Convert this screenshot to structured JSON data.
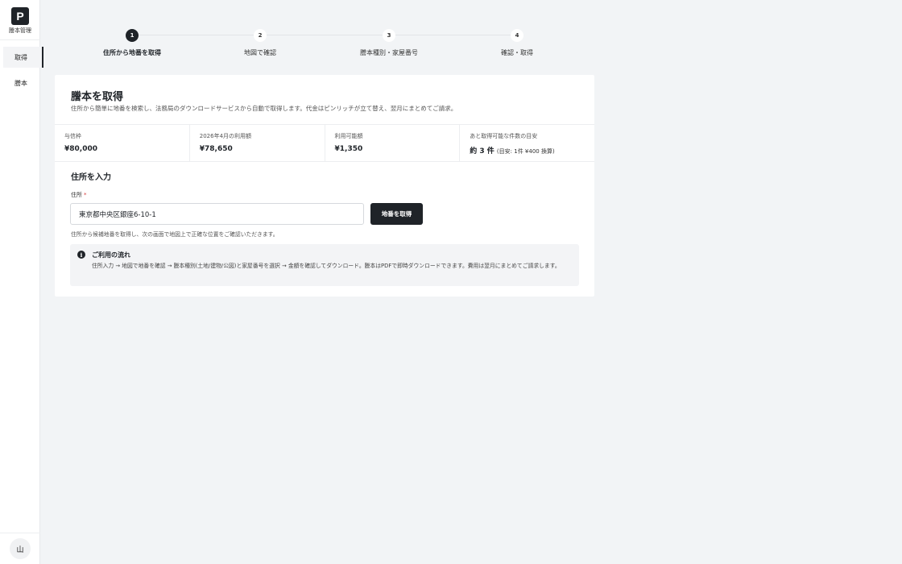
{
  "sidebar": {
    "logo_letter": "P",
    "logo_caption": "謄本管理",
    "items": [
      {
        "label": "取得",
        "active": true
      },
      {
        "label": "謄本",
        "active": false
      }
    ],
    "avatar": "山"
  },
  "stepper": {
    "steps": [
      {
        "num": "1",
        "label": "住所から地番を取得",
        "active": true
      },
      {
        "num": "2",
        "label": "地図で確認",
        "active": false
      },
      {
        "num": "3",
        "label": "謄本種別・家屋番号",
        "active": false
      },
      {
        "num": "4",
        "label": "確認・取得",
        "active": false
      }
    ]
  },
  "page": {
    "title": "謄本を取得",
    "description": "住所から簡単に地番を検索し、法務局のダウンロードサービスから自動で取得します。代金はピンリッチが立て替え、翌月にまとめてご請求。"
  },
  "stats": [
    {
      "label": "与信枠",
      "value": "¥80,000",
      "note": ""
    },
    {
      "label": "2026年4月の利用額",
      "value": "¥78,650",
      "note": ""
    },
    {
      "label": "利用可能額",
      "value": "¥1,350",
      "note": ""
    },
    {
      "label": "あと取得可能な件数の目安",
      "value": "約 3 件",
      "note": "(目安: 1件 ¥400 換算)"
    }
  ],
  "form": {
    "section_title": "住所を入力",
    "address_label": "住所",
    "required_mark": "*",
    "address_value": "東京都中央区銀座6-10-1",
    "submit_label": "地番を取得",
    "hint": "住所から候補地番を取得し、次の画面で地図上で正確な位置をご確認いただきます。"
  },
  "flow": {
    "icon": "info-icon",
    "title": "ご利用の流れ",
    "body": "住所入力 → 地図で地番を確認 → 謄本種別(土地/建物/公図)と家屋番号を選択 → 金額を確認してダウンロード。謄本はPDFで即時ダウンロードできます。費用は翌月にまとめてご請求します。"
  },
  "colors": {
    "accent": "#1f2328",
    "background": "#f2f4f6",
    "required": "#d63c3c"
  }
}
